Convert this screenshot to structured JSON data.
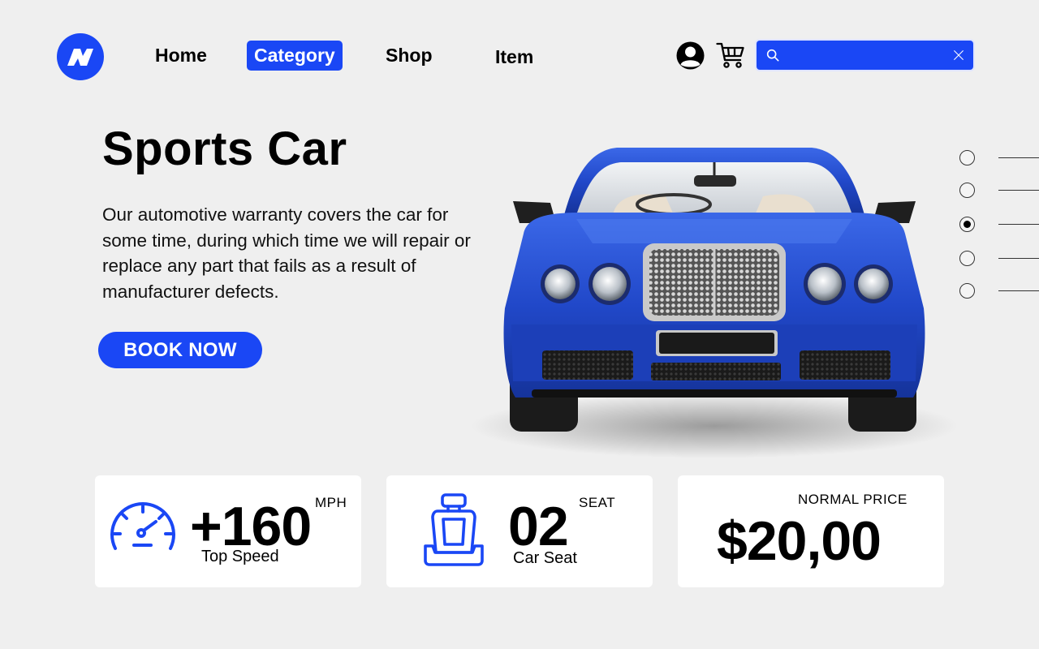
{
  "nav": {
    "items": [
      {
        "label": "Home"
      },
      {
        "label": "Category",
        "active": true
      },
      {
        "label": "Shop"
      },
      {
        "label": "Item"
      }
    ]
  },
  "header": {
    "search_placeholder": "",
    "icons": [
      "logo-icon",
      "user-icon",
      "cart-icon",
      "search-icon",
      "close-icon"
    ]
  },
  "hero": {
    "title": "Sports Car",
    "description": "Our automotive warranty covers the car for some time, during which time we will repair or replace any part that fails as a result of manufacturer defects.",
    "cta_label": "BOOK NOW"
  },
  "slider": {
    "count": 5,
    "active_index": 2
  },
  "stats": {
    "speed": {
      "value": "+160",
      "unit": "MPH",
      "label": "Top Speed"
    },
    "seat": {
      "value": "02",
      "unit": "SEAT",
      "label": "Car Seat"
    },
    "price": {
      "label": "NORMAL PRICE",
      "value": "$20,00"
    }
  },
  "colors": {
    "accent": "#1a47f5",
    "background": "#efefef",
    "card": "#ffffff"
  }
}
